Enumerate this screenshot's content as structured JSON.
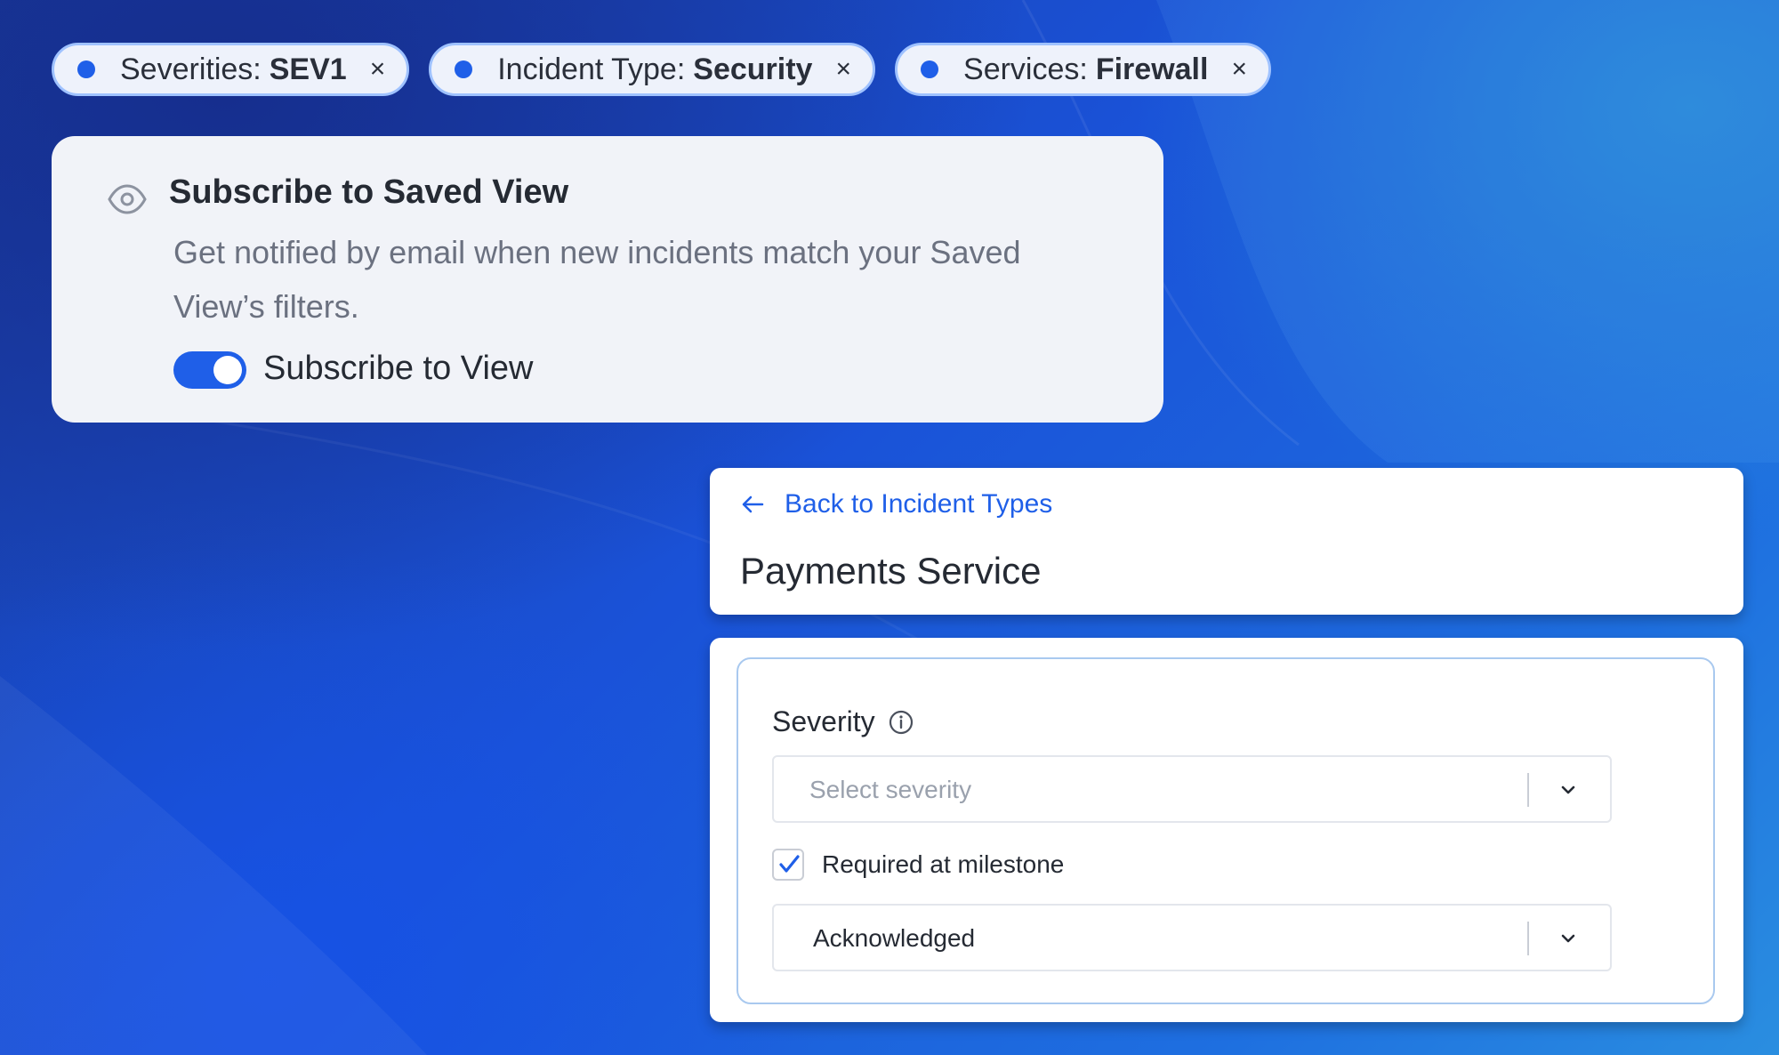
{
  "filters": [
    {
      "key": "Severities:",
      "value": "SEV1"
    },
    {
      "key": "Incident Type:",
      "value": "Security"
    },
    {
      "key": "Services:",
      "value": "Firewall"
    }
  ],
  "filter_remove_glyph": "×",
  "subscribe_card": {
    "title": "Subscribe to Saved View",
    "description": "Get notified by email when new incidents match your Saved View’s filters.",
    "toggle_label": "Subscribe to View",
    "toggle_on": true
  },
  "incident_type": {
    "back_link": "Back to Incident Types",
    "title": "Payments Service"
  },
  "severity_field": {
    "label": "Severity",
    "select_placeholder": "Select severity",
    "checkbox_label": "Required at milestone",
    "checkbox_checked": true,
    "milestone_value": "Acknowledged"
  },
  "colors": {
    "accent": "#1f5fe8",
    "chip_border": "#9fc2ff",
    "card_bg": "#f1f3f8",
    "inner_border": "#a9c9ef"
  },
  "icons": [
    "eye-icon",
    "arrow-left-icon",
    "info-icon",
    "chevron-down-icon",
    "check-icon",
    "close-icon"
  ]
}
